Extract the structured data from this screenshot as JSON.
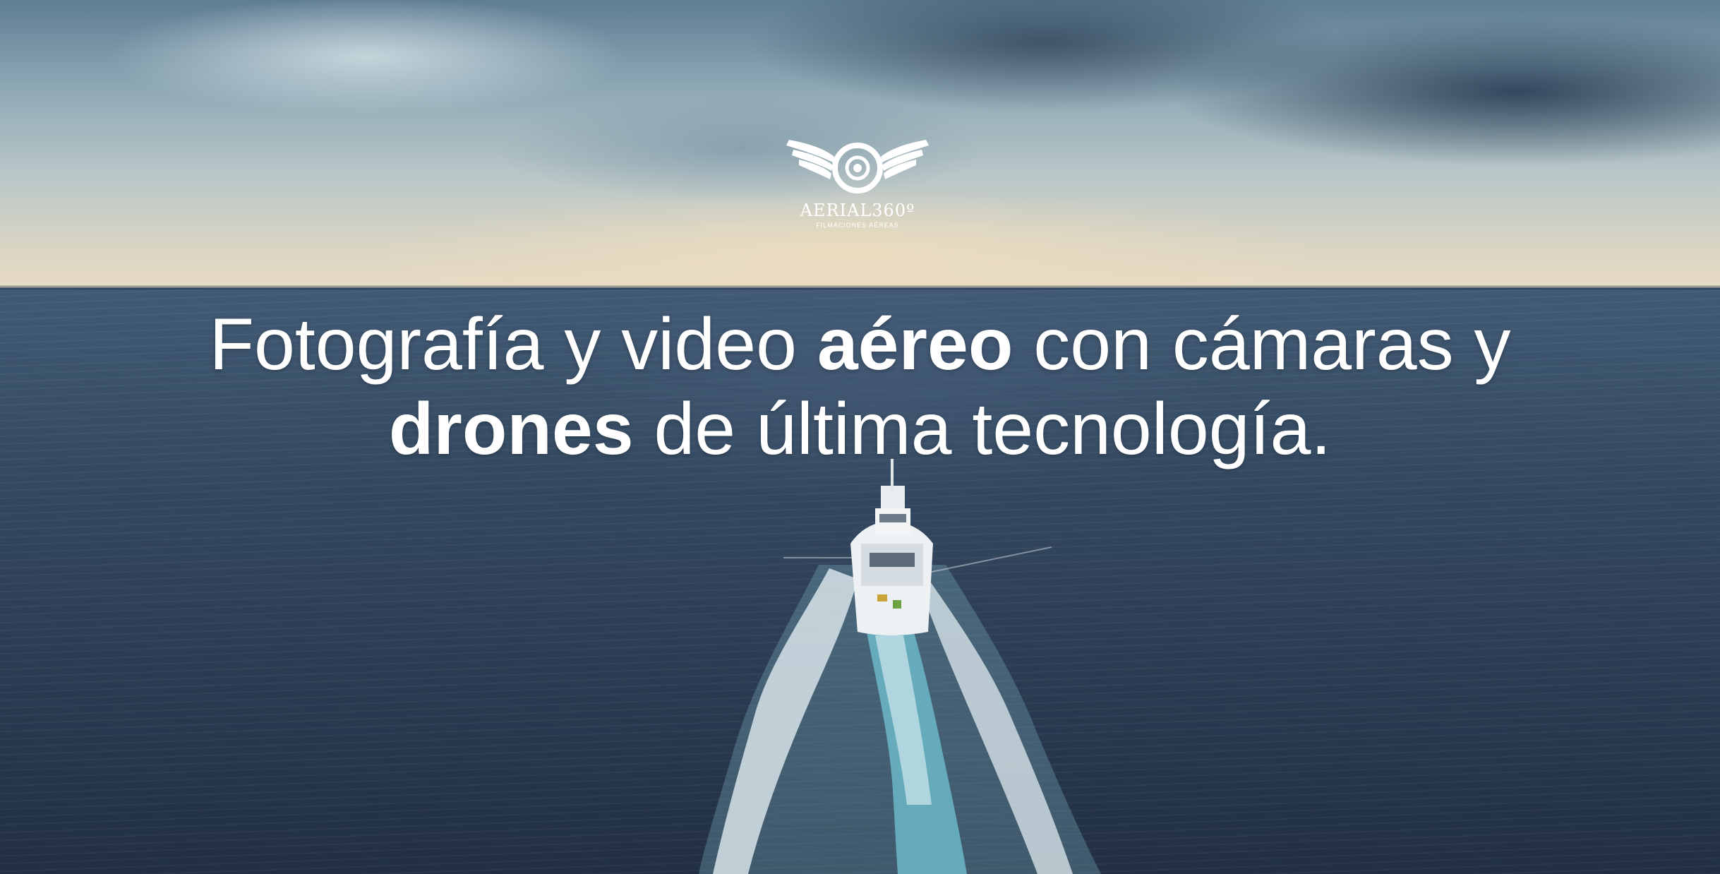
{
  "logo": {
    "name": "AERIAL360º",
    "tagline": "FILMACIONES AÉREAS",
    "icon": "winged-camera-lens-icon"
  },
  "headline": {
    "line1_part1": "Fotografía y video ",
    "line1_bold": "aéreo",
    "line1_part2": " con cámaras y",
    "line2_bold": "drones",
    "line2_part2": " de última tecnología."
  },
  "colors": {
    "text": "#ffffff",
    "sea": "#2a3a50",
    "sky": "#b8c6c7"
  }
}
